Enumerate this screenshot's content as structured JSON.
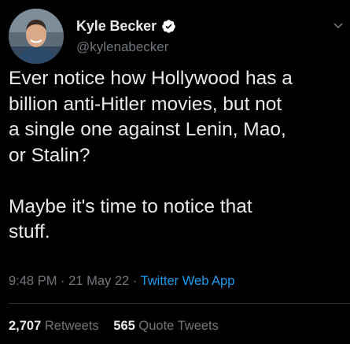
{
  "author": {
    "display_name": "Kyle Becker",
    "handle": "@kylenabecker",
    "verified": true,
    "avatar_icon": "profile-photo"
  },
  "tweet": {
    "text": "Ever notice how Hollywood has a\nbillion anti-Hitler movies, but not\na single one against Lenin, Mao,\nor Stalin?\n\nMaybe it's time to notice that\nstuff.",
    "time": "9:48 PM",
    "separator": "·",
    "date": "21 May 22",
    "source": "Twitter Web App"
  },
  "stats": {
    "retweets_count": "2,707",
    "retweets_label": "Retweets",
    "quotes_count": "565",
    "quotes_label": "Quote Tweets"
  },
  "colors": {
    "background": "#000000",
    "text": "#e7e9ea",
    "secondary": "#71767b",
    "link": "#1d9bf0",
    "verified_badge": "#ffffff"
  }
}
